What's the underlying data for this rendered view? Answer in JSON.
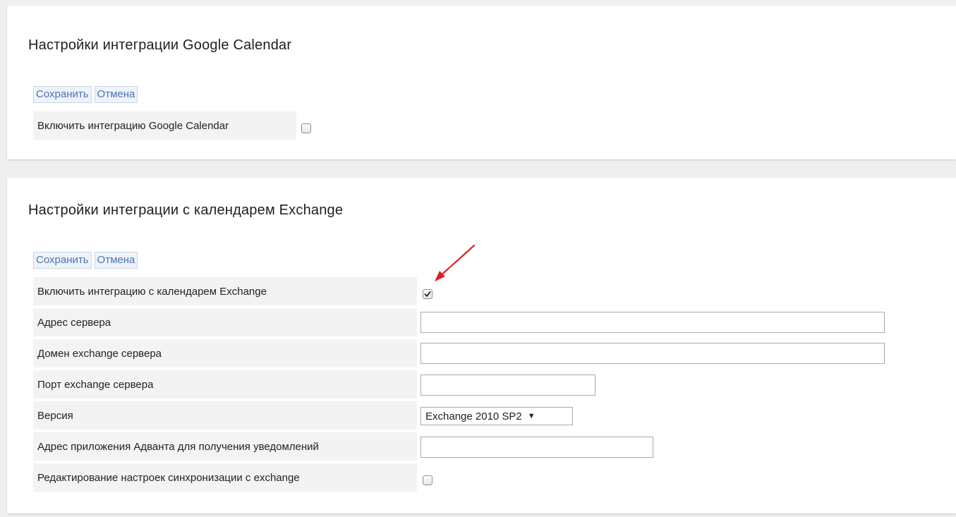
{
  "google": {
    "title": "Настройки интеграции Google Calendar",
    "save_label": "Сохранить",
    "cancel_label": "Отмена",
    "enable_label": "Включить интеграцию Google Calendar",
    "enable_checked": false
  },
  "exchange": {
    "title": "Настройки интеграции с календарем Exchange",
    "save_label": "Сохранить",
    "cancel_label": "Отмена",
    "enable_label": "Включить интеграцию с календарем Exchange",
    "enable_checked": true,
    "server_address_label": "Адрес сервера",
    "server_address_value": "",
    "domain_label": "Домен exchange сервера",
    "domain_value": "",
    "port_label": "Порт exchange сервера",
    "port_value": "",
    "version_label": "Версия",
    "version_selected": "Exchange 2010 SP2",
    "notify_address_label": "Адрес приложения Адванта для получения уведомлений",
    "notify_address_value": "",
    "edit_sync_label": "Редактирование настроек синхронизации с exchange",
    "edit_sync_checked": false
  },
  "colors": {
    "link_blue": "#4a74b7",
    "label_bg": "#f3f3f3",
    "annotation_arrow": "#e02020"
  },
  "icons": {
    "checkmark": "checkmark-icon",
    "dropdown": "dropdown-triangle-icon",
    "annotation": "red-arrow-annotation"
  }
}
